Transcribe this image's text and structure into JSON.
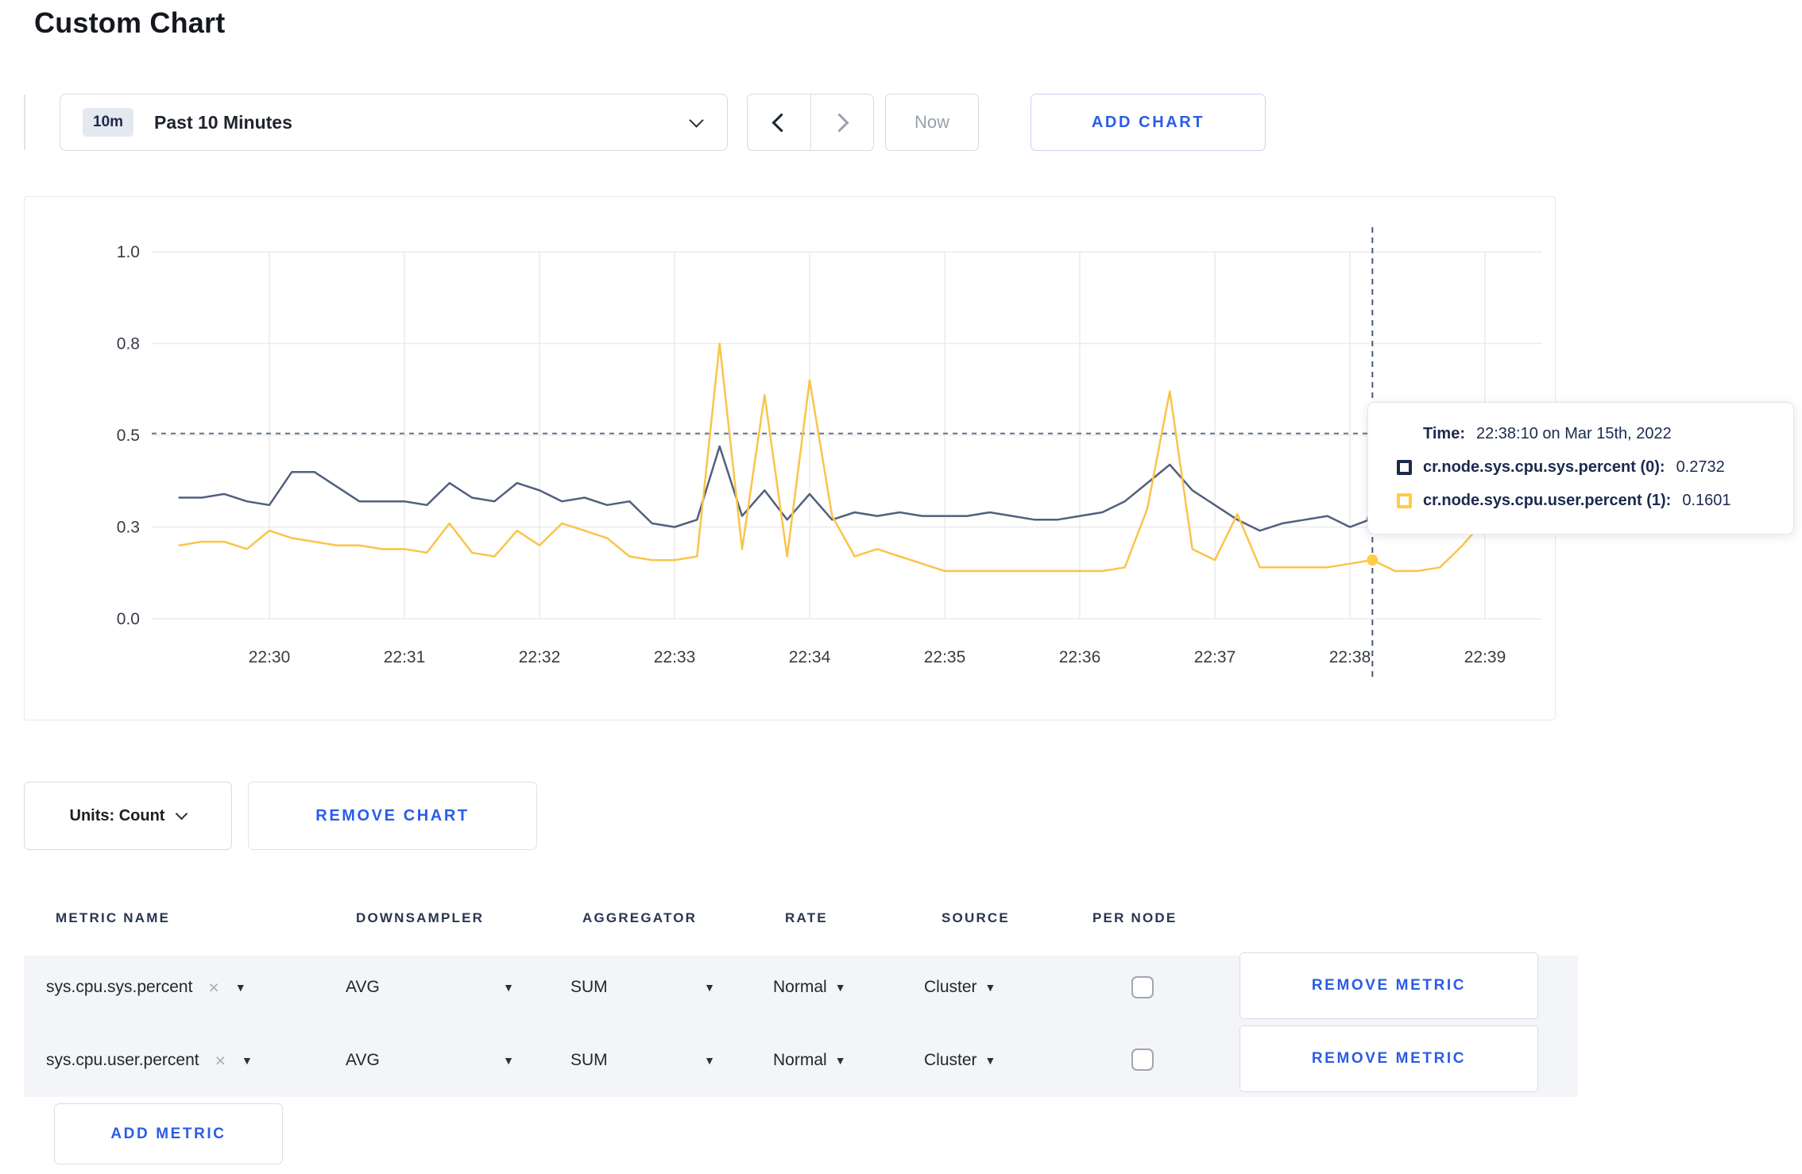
{
  "page": {
    "title": "Custom Chart",
    "accent_blue": "#2b5ce7"
  },
  "toolbar": {
    "time_range": {
      "badge": "10m",
      "selected": "Past 10 Minutes"
    },
    "now_label": "Now",
    "add_chart_label": "ADD CHART"
  },
  "chart_data": {
    "type": "line",
    "title": "",
    "x_axis": {
      "tick_labels": [
        "22:30",
        "22:31",
        "22:32",
        "22:33",
        "22:34",
        "22:35",
        "22:36",
        "22:37",
        "22:38",
        "22:39"
      ],
      "start_time": "22:29:20",
      "step_seconds": 10
    },
    "y_axis": {
      "tick_labels": [
        "0.0",
        "0.3",
        "0.5",
        "0.8",
        "1.0"
      ],
      "tick_values": [
        0,
        0.25,
        0.5,
        0.75,
        1.0
      ],
      "range": [
        0,
        1.0
      ]
    },
    "grid": true,
    "legend_position": "tooltip",
    "series": [
      {
        "name": "cr.node.sys.cpu.sys.percent",
        "color": "#51607d",
        "swatch_color": "#1c2b4a",
        "values": [
          0.33,
          0.33,
          0.34,
          0.32,
          0.31,
          0.4,
          0.4,
          0.36,
          0.32,
          0.32,
          0.32,
          0.31,
          0.37,
          0.33,
          0.32,
          0.37,
          0.35,
          0.32,
          0.33,
          0.31,
          0.32,
          0.26,
          0.25,
          0.27,
          0.47,
          0.28,
          0.35,
          0.27,
          0.34,
          0.27,
          0.29,
          0.28,
          0.29,
          0.28,
          0.28,
          0.28,
          0.29,
          0.28,
          0.27,
          0.27,
          0.28,
          0.29,
          0.32,
          0.37,
          0.42,
          0.35,
          0.31,
          0.27,
          0.24,
          0.26,
          0.27,
          0.28,
          0.25,
          0.2732,
          0.25,
          0.26,
          0.28,
          0.29,
          0.3,
          0.29,
          0.3
        ]
      },
      {
        "name": "cr.node.sys.cpu.user.percent",
        "color": "#fbc449",
        "swatch_color": "#ffcc43",
        "values": [
          0.2,
          0.21,
          0.21,
          0.19,
          0.24,
          0.22,
          0.21,
          0.2,
          0.2,
          0.19,
          0.19,
          0.18,
          0.26,
          0.18,
          0.17,
          0.24,
          0.2,
          0.26,
          0.24,
          0.22,
          0.17,
          0.16,
          0.16,
          0.17,
          0.75,
          0.19,
          0.61,
          0.17,
          0.65,
          0.28,
          0.17,
          0.19,
          0.17,
          0.15,
          0.13,
          0.13,
          0.13,
          0.13,
          0.13,
          0.13,
          0.13,
          0.13,
          0.14,
          0.3,
          0.62,
          0.19,
          0.16,
          0.285,
          0.14,
          0.14,
          0.14,
          0.14,
          0.15,
          0.1601,
          0.13,
          0.13,
          0.14,
          0.2,
          0.27,
          0.24,
          0.26
        ]
      }
    ],
    "crosshair": {
      "index": 53,
      "time": "22:38:10",
      "guide_value": 0.505,
      "marker_values": [
        0.2732,
        0.1601
      ]
    }
  },
  "tooltip": {
    "time_label": "Time:",
    "time_value": "22:38:10 on Mar 15th, 2022",
    "rows": [
      {
        "label": "cr.node.sys.cpu.sys.percent (0):",
        "value": "0.2732"
      },
      {
        "label": "cr.node.sys.cpu.user.percent (1):",
        "value": "0.1601"
      }
    ]
  },
  "chart_controls": {
    "units_label": "Units: Count",
    "remove_chart_label": "REMOVE CHART"
  },
  "metrics_table": {
    "headers": [
      "METRIC NAME",
      "DOWNSAMPLER",
      "AGGREGATOR",
      "RATE",
      "SOURCE",
      "PER NODE"
    ],
    "rows": [
      {
        "metric": "sys.cpu.sys.percent",
        "downsampler": "AVG",
        "aggregator": "SUM",
        "rate": "Normal",
        "source": "Cluster",
        "per_node_checked": false,
        "remove_label": "REMOVE METRIC"
      },
      {
        "metric": "sys.cpu.user.percent",
        "downsampler": "AVG",
        "aggregator": "SUM",
        "rate": "Normal",
        "source": "Cluster",
        "per_node_checked": false,
        "remove_label": "REMOVE METRIC"
      }
    ],
    "add_metric_label": "ADD METRIC"
  },
  "icons": {
    "caret_down": "▼",
    "clear": "×"
  }
}
